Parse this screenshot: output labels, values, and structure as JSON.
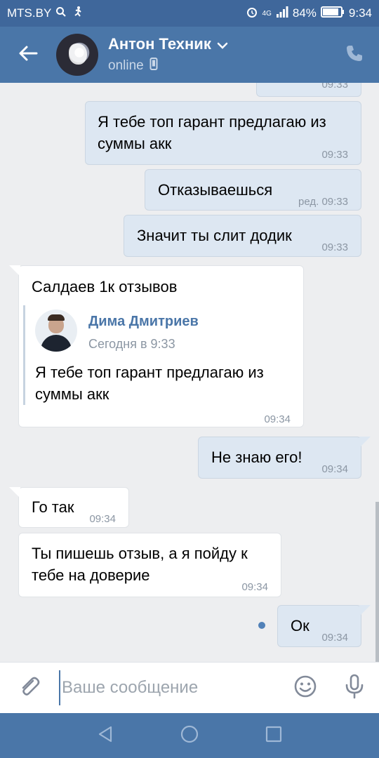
{
  "status_bar": {
    "carrier": "MTS.BY",
    "network": "4G",
    "battery": "84%",
    "time": "9:34"
  },
  "header": {
    "name": "Антон Техник",
    "status": "online"
  },
  "messages": [
    {
      "type": "out",
      "text": "",
      "time": "09:33"
    },
    {
      "type": "out",
      "text": "Я тебе топ гарант предлагаю из суммы акк",
      "time": "09:33"
    },
    {
      "type": "out",
      "text": "Отказываешься",
      "time": "ред. 09:33"
    },
    {
      "type": "out",
      "text": "Значит ты слит додик",
      "time": "09:33"
    },
    {
      "type": "in",
      "text": "Салдаев 1к отзывов",
      "time": "09:34",
      "forwarded": {
        "author": "Дима Дмитриев",
        "date": "Сегодня в 9:33",
        "text": "Я тебе топ гарант предлагаю из суммы акк"
      }
    },
    {
      "type": "out",
      "text": "Не знаю его!",
      "time": "09:34"
    },
    {
      "type": "in",
      "text": "Го так",
      "time": "09:34"
    },
    {
      "type": "in",
      "text": "Ты пишешь отзыв, а я пойду к тебе на доверие",
      "time": "09:34"
    },
    {
      "type": "out",
      "text": "Ок",
      "time": "09:34"
    }
  ],
  "composer": {
    "placeholder": "Ваше сообщение"
  },
  "colors": {
    "header": "#4a76a8",
    "status_bar": "#3f679b",
    "outgoing_bubble": "#dde7f2",
    "incoming_bubble": "#ffffff",
    "background": "#edeef0",
    "link": "#4a76a8"
  },
  "icons": [
    "back-arrow-icon",
    "chevron-down-icon",
    "mobile-icon",
    "phone-icon",
    "paperclip-icon",
    "smiley-icon",
    "microphone-icon",
    "nav-back-icon",
    "nav-home-icon",
    "nav-recents-icon"
  ]
}
